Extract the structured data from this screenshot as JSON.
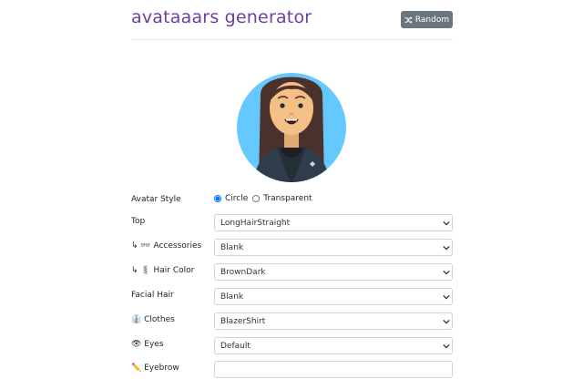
{
  "header": {
    "title": "avataaars generator",
    "random_label": "Random"
  },
  "form": {
    "avatar_style": {
      "label": "Avatar Style",
      "options": [
        "Circle",
        "Transparent"
      ],
      "selected": "Circle"
    },
    "rows": [
      {
        "label": "Top",
        "value": "LongHairStraight"
      },
      {
        "label": "↳ 👓 Accessories",
        "value": "Blank"
      },
      {
        "label": "↳ 💈 Hair Color",
        "value": "BrownDark"
      },
      {
        "label": "Facial Hair",
        "value": "Blank"
      },
      {
        "label": "👔 Clothes",
        "value": "BlazerShirt"
      },
      {
        "label": "👁 Eyes",
        "value": "Default"
      },
      {
        "label": "✏️ Eyebrow",
        "value": ""
      }
    ]
  },
  "colors": {
    "title": "#6b3fa0",
    "button": "#6c757d",
    "circle": "#65c9ff",
    "hair": "#4a312c",
    "skin": "#f4c088"
  }
}
